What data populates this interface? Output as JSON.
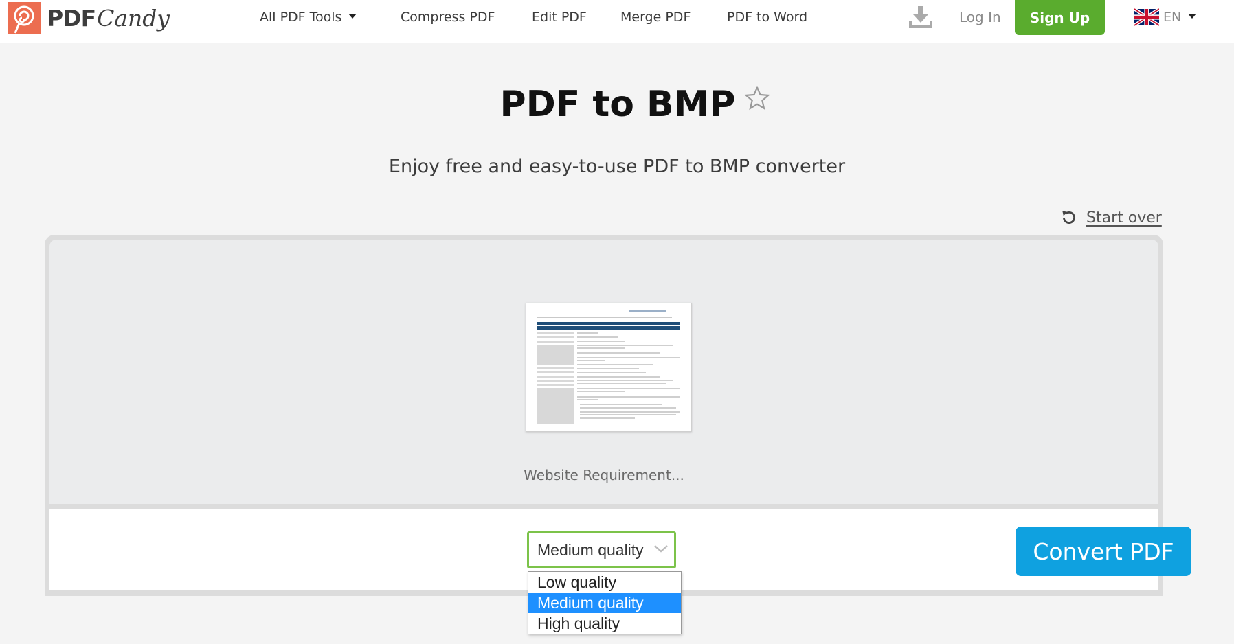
{
  "header": {
    "logo_text_bold": "PDF",
    "logo_text_script": "Candy",
    "nav": [
      {
        "label": "All PDF Tools",
        "has_caret": true
      },
      {
        "label": "Compress PDF"
      },
      {
        "label": "Edit PDF"
      },
      {
        "label": "Merge PDF"
      },
      {
        "label": "PDF to Word"
      }
    ],
    "login_label": "Log In",
    "signup_label": "Sign Up",
    "language_code": "EN",
    "accent_green": "#5aac2e"
  },
  "main": {
    "title": "PDF to BMP",
    "subtitle": "Enjoy free and easy-to-use PDF to BMP converter",
    "start_over_label": "Start over"
  },
  "file": {
    "name": "Website Requirement..."
  },
  "options": {
    "quality_selected": "Medium quality",
    "quality_options": [
      "Low quality",
      "Medium quality",
      "High quality"
    ],
    "convert_label": "Convert PDF",
    "convert_color": "#0fa1e0"
  }
}
